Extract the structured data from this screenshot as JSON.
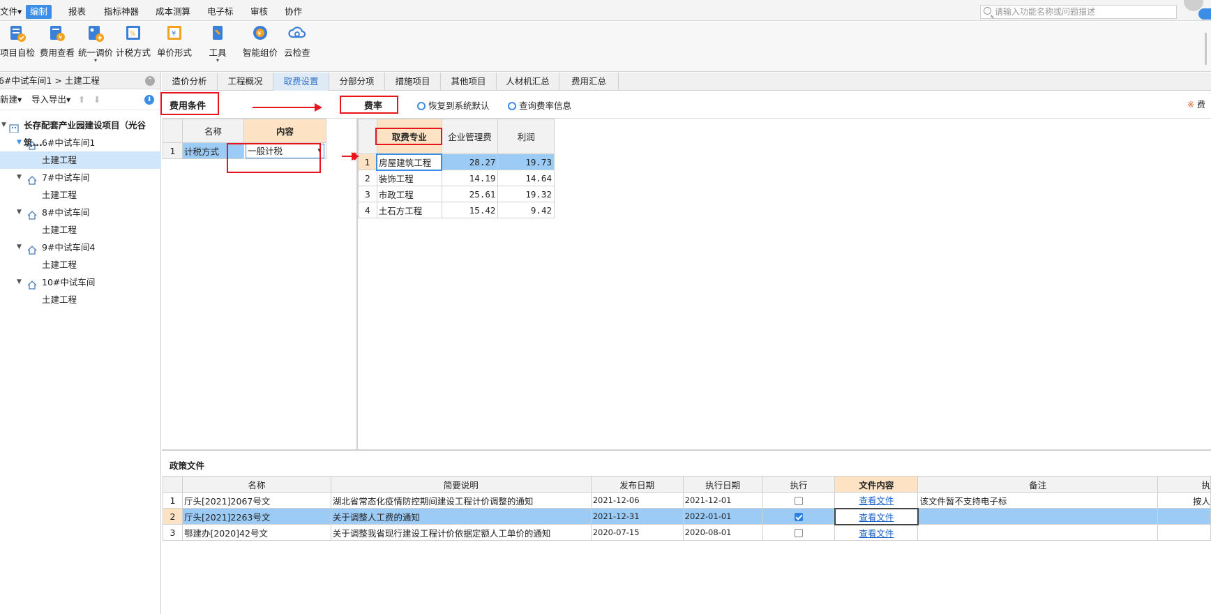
{
  "menubar": {
    "items": [
      "文件",
      "编制",
      "报表",
      "指标神器",
      "成本测算",
      "电子标",
      "审核",
      "协作"
    ],
    "active": "编制",
    "file_suffix": "▾",
    "search_placeholder": "请输入功能名称或问题描述"
  },
  "ribbon": {
    "buttons": [
      {
        "label": "项目自检",
        "icon": "project-check-icon",
        "has_dropdown": false
      },
      {
        "label": "费用查看",
        "icon": "cost-view-icon",
        "has_dropdown": false
      },
      {
        "label": "统一调价",
        "icon": "unified-price-icon",
        "has_dropdown": true
      },
      {
        "label": "计税方式",
        "icon": "tax-method-icon",
        "has_dropdown": false
      },
      {
        "label": "单价形式",
        "icon": "unit-price-icon",
        "has_dropdown": false
      },
      {
        "label": "工具",
        "icon": "tools-icon",
        "has_dropdown": true
      },
      {
        "label": "智能组价",
        "icon": "smart-pricing-icon",
        "has_dropdown": false
      },
      {
        "label": "云检查",
        "icon": "cloud-check-icon",
        "has_dropdown": false
      }
    ]
  },
  "left": {
    "breadcrumb": "6#中试车间1 > 土建工程",
    "new_label": "新建",
    "import_export_label": "导入导出",
    "tree": {
      "root": "长存配套产业园建设项目（光谷筑...",
      "children": [
        {
          "name": "6#中试车间1",
          "child": "土建工程",
          "selected": true
        },
        {
          "name": "7#中试车间",
          "child": "土建工程",
          "selected": false
        },
        {
          "name": "8#中试车间",
          "child": "土建工程",
          "selected": false
        },
        {
          "name": "9#中试车间4",
          "child": "土建工程",
          "selected": false
        },
        {
          "name": "10#中试车间",
          "child": "土建工程",
          "selected": false
        }
      ]
    }
  },
  "tabs": {
    "items": [
      "造价分析",
      "工程概况",
      "取费设置",
      "分部分项",
      "措施项目",
      "其他项目",
      "人材机汇总",
      "费用汇总"
    ],
    "active": "取费设置"
  },
  "fee_conditions": {
    "title": "费用条件",
    "headers": [
      "名称",
      "内容"
    ],
    "rows": [
      {
        "no": "1",
        "name": "计税方式",
        "content": "一般计税"
      }
    ]
  },
  "fee_rate": {
    "title": "费率",
    "restore_label": "恢复到系统默认",
    "query_label": "查询费率信息",
    "right_label": "费",
    "headers": [
      "取费专业",
      "企业管理费",
      "利润"
    ],
    "rows": [
      {
        "no": "1",
        "name": "房屋建筑工程",
        "mgmt": "28.27",
        "profit": "19.73"
      },
      {
        "no": "2",
        "name": "装饰工程",
        "mgmt": "14.19",
        "profit": "14.64"
      },
      {
        "no": "3",
        "name": "市政工程",
        "mgmt": "25.61",
        "profit": "19.32"
      },
      {
        "no": "4",
        "name": "土石方工程",
        "mgmt": "15.42",
        "profit": "9.42"
      }
    ]
  },
  "policy": {
    "title": "政策文件",
    "headers": [
      "名称",
      "简要说明",
      "发布日期",
      "执行日期",
      "执行",
      "文件内容",
      "备注",
      "执"
    ],
    "rows": [
      {
        "no": "1",
        "name": "厅头[2021]2067号文",
        "desc": "湖北省常态化疫情防控期间建设工程计价调整的通知",
        "pub": "2021-12-06",
        "exec": "2021-12-01",
        "checked": false,
        "file": "查看文件",
        "note": "该文件暂不支持电子标",
        "extra": "按人"
      },
      {
        "no": "2",
        "name": "厅头[2021]2263号文",
        "desc": "关于调整人工费的通知",
        "pub": "2021-12-31",
        "exec": "2022-01-01",
        "checked": true,
        "file": "查看文件",
        "note": "",
        "extra": ""
      },
      {
        "no": "3",
        "name": "鄂建办[2020]42号文",
        "desc": "关于调整我省现行建设工程计价依据定额人工单价的通知",
        "pub": "2020-07-15",
        "exec": "2020-08-01",
        "checked": false,
        "file": "查看文件",
        "note": "",
        "extra": ""
      }
    ]
  },
  "colors": {
    "accent": "#3b8de6",
    "selected_row": "#9ccbf5",
    "annotation_red": "#e8141b",
    "header_orange": "#fde3c4"
  }
}
